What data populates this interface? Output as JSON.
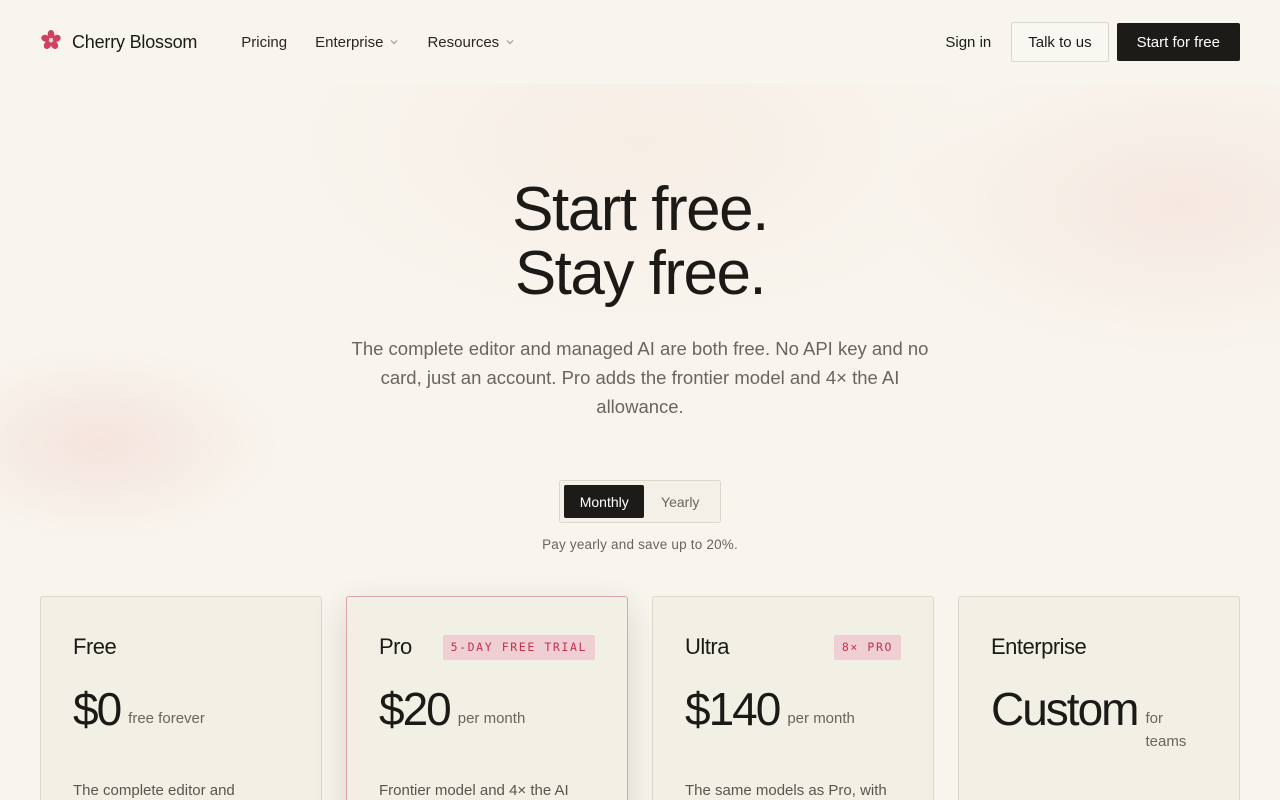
{
  "header": {
    "brand": "Cherry Blossom",
    "nav": [
      {
        "label": "Pricing",
        "has_dropdown": false
      },
      {
        "label": "Enterprise",
        "has_dropdown": true
      },
      {
        "label": "Resources",
        "has_dropdown": true
      }
    ],
    "sign_in": "Sign in",
    "talk": "Talk to us",
    "start": "Start for free"
  },
  "hero": {
    "title_line1": "Start free.",
    "title_line2": "Stay free.",
    "subtitle": "The complete editor and managed AI are both free. No API key and no card, just an account. Pro adds the frontier model and 4× the AI allowance."
  },
  "billing": {
    "monthly": "Monthly",
    "yearly": "Yearly",
    "selected": "Monthly",
    "note": "Pay yearly and save up to 20%."
  },
  "plans": [
    {
      "name": "Free",
      "badge": "",
      "price": "$0",
      "period": "free forever",
      "desc": "The complete editor and"
    },
    {
      "name": "Pro",
      "badge": "5-DAY FREE TRIAL",
      "price": "$20",
      "period": "per month",
      "desc": "Frontier model and 4× the AI"
    },
    {
      "name": "Ultra",
      "badge": "8× PRO",
      "price": "$140",
      "period": "per month",
      "desc": "The same models as Pro, with"
    },
    {
      "name": "Enterprise",
      "badge": "",
      "price": "Custom",
      "period": "for teams",
      "desc": ""
    }
  ],
  "colors": {
    "accent": "#c2324f",
    "badge_bg": "#f0cfd4",
    "dark": "#1d1b18",
    "background": "#f8f5ee"
  },
  "icons": {
    "logo": "cherry-blossom-icon",
    "dropdown": "chevron-down-icon"
  }
}
